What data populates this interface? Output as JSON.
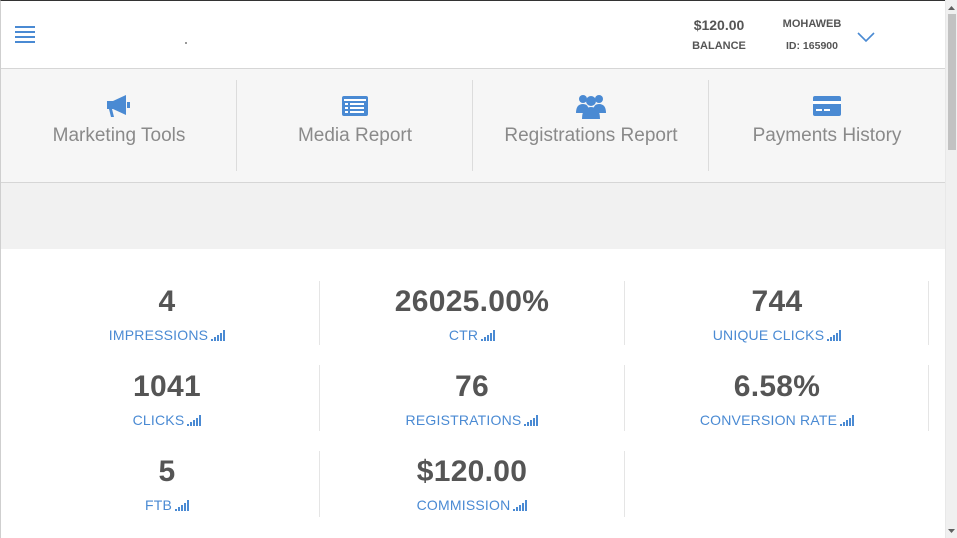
{
  "header": {
    "balance_amount": "$120.00",
    "balance_label": "BALANCE",
    "user_name": "MOHAWEB",
    "user_id": "ID: 165900"
  },
  "nav": {
    "items": [
      {
        "label": "Marketing Tools",
        "icon": "megaphone-icon"
      },
      {
        "label": "Media Report",
        "icon": "media-report-icon"
      },
      {
        "label": "Registrations Report",
        "icon": "users-icon"
      },
      {
        "label": "Payments History",
        "icon": "credit-card-icon"
      }
    ]
  },
  "stats": [
    {
      "value": "4",
      "label": "IMPRESSIONS"
    },
    {
      "value": "26025.00%",
      "label": "CTR"
    },
    {
      "value": "744",
      "label": "UNIQUE CLICKS"
    },
    {
      "value": "1041",
      "label": "CLICKS"
    },
    {
      "value": "76",
      "label": "REGISTRATIONS"
    },
    {
      "value": "6.58%",
      "label": "CONVERSION RATE"
    },
    {
      "value": "5",
      "label": "FTB"
    },
    {
      "value": "$120.00",
      "label": "COMMISSION"
    }
  ],
  "colors": {
    "accent": "#4a8ad3",
    "text": "#555555",
    "nav_text": "#8a8a8a",
    "nav_bg": "#f6f6f6"
  }
}
